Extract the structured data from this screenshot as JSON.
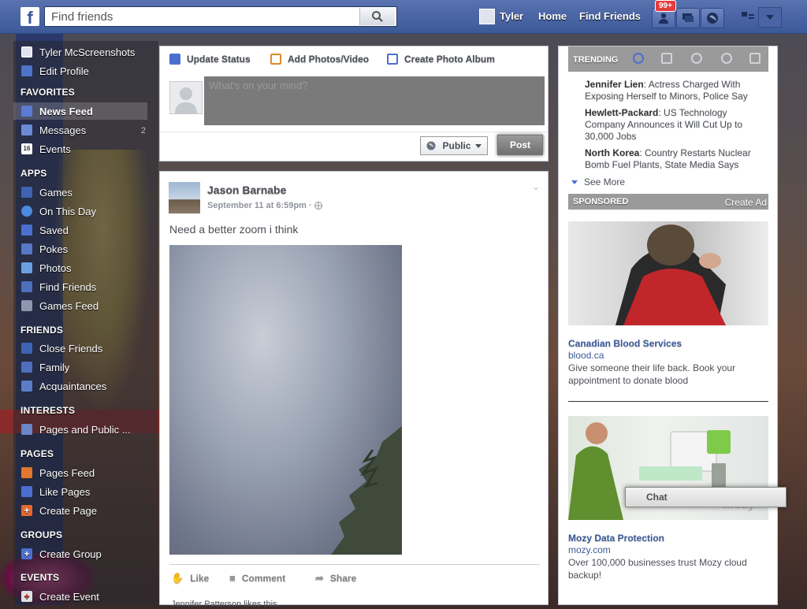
{
  "topbar": {
    "logo": "f",
    "search_placeholder": "Find friends",
    "user_name": "Tyler",
    "home": "Home",
    "find_friends": "Find Friends",
    "notification_count": "99+",
    "accent": "#3b5998"
  },
  "sidebar": {
    "profile_name": "Tyler McScreenshots",
    "edit_profile": "Edit Profile",
    "sections": {
      "favorites": "FAVORITES",
      "apps": "APPS",
      "friends": "FRIENDS",
      "interests": "INTERESTS",
      "pages": "PAGES",
      "groups": "GROUPS",
      "events": "EVENTS"
    },
    "favorites": [
      {
        "label": "News Feed",
        "icon": "news-feed-icon"
      },
      {
        "label": "Messages",
        "icon": "messages-icon",
        "count": "2"
      },
      {
        "label": "Events",
        "icon": "calendar-icon",
        "icon_text": "16"
      }
    ],
    "apps": [
      {
        "label": "Games",
        "icon": "games-icon"
      },
      {
        "label": "On This Day",
        "icon": "clock-icon"
      },
      {
        "label": "Saved",
        "icon": "bookmark-icon"
      },
      {
        "label": "Pokes",
        "icon": "poke-icon"
      },
      {
        "label": "Photos",
        "icon": "photos-icon"
      },
      {
        "label": "Find Friends",
        "icon": "find-friends-icon"
      },
      {
        "label": "Games Feed",
        "icon": "gamepad-icon"
      }
    ],
    "friends": [
      {
        "label": "Close Friends",
        "icon": "star-icon"
      },
      {
        "label": "Family",
        "icon": "family-icon"
      },
      {
        "label": "Acquaintances",
        "icon": "acquaintances-icon"
      }
    ],
    "interests": [
      {
        "label": "Pages and Public ...",
        "icon": "rss-icon"
      }
    ],
    "pages": [
      {
        "label": "Pages Feed",
        "icon": "flag-icon"
      },
      {
        "label": "Like Pages",
        "icon": "thumb-up-icon"
      },
      {
        "label": "Create Page",
        "icon": "plus-icon"
      }
    ],
    "groups": [
      {
        "label": "Create Group",
        "icon": "plus-icon"
      }
    ],
    "events": [
      {
        "label": "Create Event",
        "icon": "plus-icon"
      }
    ]
  },
  "composer": {
    "tabs": [
      "Update Status",
      "Add Photos/Video",
      "Create Photo Album"
    ],
    "placeholder": "What's on your mind?",
    "privacy": "Public",
    "post": "Post"
  },
  "story": {
    "author": "Jason Barnabe",
    "date": "September 11 at 6:59pm",
    "text": "Need a better zoom i think",
    "actions": [
      "Like",
      "Comment",
      "Share"
    ],
    "likes_line": "Jennifer Patterson likes this."
  },
  "trending": {
    "label": "TRENDING",
    "items": [
      {
        "name": "Jennifer Lien",
        "text": ": Actress Charged With Exposing Herself to Minors, Police Say"
      },
      {
        "name": "Hewlett-Packard",
        "text": ": US Technology Company Announces it Will Cut Up to 30,000 Jobs"
      },
      {
        "name": "North Korea",
        "text": ": Country Restarts Nuclear Bomb Fuel Plants, State Media Says"
      }
    ],
    "see_more": "See More"
  },
  "sponsored": {
    "label": "SPONSORED",
    "create_ad": "Create Ad",
    "ads": [
      {
        "title": "Canadian Blood Services",
        "url": "blood.ca",
        "desc": "Give someone their life back. Book your appointment to donate blood"
      },
      {
        "title": "Mozy Data Protection",
        "url": "mozy.com",
        "desc": "Over 100,000 businesses trust Mozy cloud backup!",
        "logo_text": "mozy"
      }
    ]
  },
  "chat": {
    "label": "Chat"
  }
}
